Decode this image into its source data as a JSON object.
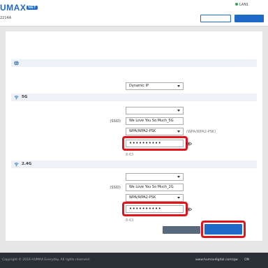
{
  "header": {
    "logo_text": "UMAX",
    "logo_badge": "NET",
    "device_info": "2214A  ",
    "lan_status": "LAN1",
    "settings_button": "",
    "logout_button": ""
  },
  "page": {
    "title": "",
    "description": ""
  },
  "internet": {
    "section_title": "",
    "status_label": "",
    "status_value": "",
    "type_label": "",
    "type_value": "Dynamic IP"
  },
  "wifi5g": {
    "section_title": " 5G",
    "enable_label": "",
    "enable_value": "",
    "ssid_label": " (SSID)",
    "ssid_value": "We Love You So Much_5G",
    "security_label": "",
    "security_value": "WPA/WPA2-PSK",
    "security_note": "(WPA/WPA2-PSK)",
    "password_label": "",
    "password_value": "••••••••••",
    "password_hint": "8-63 "
  },
  "wifi24g": {
    "section_title": " 2.4G",
    "enable_label": "",
    "enable_value": "",
    "ssid_label": " (SSID)",
    "ssid_value": "We Love You So Much_2G",
    "security_label": "",
    "security_value": "WPA/WPA2-PSK",
    "password_label": "",
    "password_value": "••••••••••",
    "password_hint": "8-63 "
  },
  "actions": {
    "skip_button": "",
    "next_button": ""
  },
  "footer": {
    "copyright": "Copyright © 2016 HUMAX Everyday. All rights reserved.",
    "links": [
      "www.humaxdigital.com/gw",
      "",
      "ON"
    ]
  },
  "colors": {
    "brand": "#1f69c7",
    "highlight": "#e3131b",
    "status_error": "#e03030"
  }
}
